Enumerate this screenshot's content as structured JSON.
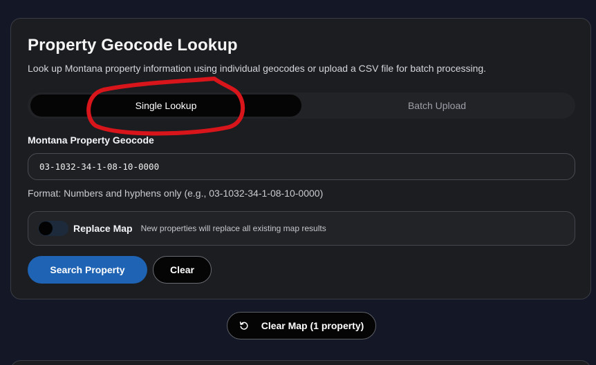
{
  "card": {
    "title": "Property Geocode Lookup",
    "description": "Look up Montana property information using individual geocodes or upload a CSV file for batch processing."
  },
  "tabs": [
    {
      "label": "Single Lookup",
      "active": true
    },
    {
      "label": "Batch Upload",
      "active": false
    }
  ],
  "geocode_field": {
    "label": "Montana Property Geocode",
    "value": "03-1032-34-1-08-10-0000",
    "hint": "Format: Numbers and hyphens only (e.g., 03-1032-34-1-08-10-0000)"
  },
  "replace_map": {
    "label": "Replace Map",
    "description": "New properties will replace all existing map results",
    "enabled": false
  },
  "actions": {
    "search_label": "Search Property",
    "clear_label": "Clear",
    "clear_map_label": "Clear Map (1 property)"
  },
  "icons": {
    "clear_map": "refresh-icon"
  },
  "colors": {
    "background": "#141826",
    "card": "#1c1d21",
    "primary": "#1e63b4",
    "annotation": "#d8151b"
  }
}
